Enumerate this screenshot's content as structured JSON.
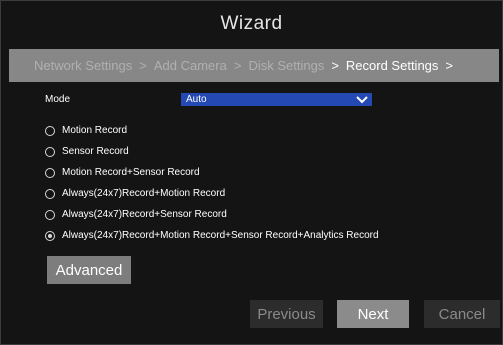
{
  "window": {
    "title": "Wizard"
  },
  "steps": [
    {
      "label": "Network Settings",
      "separator": ">",
      "active": false
    },
    {
      "label": "Add Camera",
      "separator": ">",
      "active": false
    },
    {
      "label": "Disk Settings",
      "separator": ">",
      "active": false
    },
    {
      "label": "Record Settings",
      "separator": ">",
      "active": true
    }
  ],
  "mode": {
    "label": "Mode",
    "selected": "Auto",
    "icon": "chevron-down-icon"
  },
  "record_options": [
    {
      "label": "Motion Record",
      "checked": false
    },
    {
      "label": "Sensor Record",
      "checked": false
    },
    {
      "label": "Motion Record+Sensor Record",
      "checked": false
    },
    {
      "label": "Always(24x7)Record+Motion Record",
      "checked": false
    },
    {
      "label": "Always(24x7)Record+Sensor Record",
      "checked": false
    },
    {
      "label": "Always(24x7)Record+Motion Record+Sensor Record+Analytics Record",
      "checked": true
    }
  ],
  "buttons": {
    "advanced": "Advanced",
    "previous": "Previous",
    "next": "Next",
    "cancel": "Cancel"
  },
  "colors": {
    "background": "#141414",
    "steps_bar": "#878787",
    "select_accent": "#2449b4",
    "active_button": "#8b8b8b",
    "disabled_button": "#2c2c2c"
  }
}
